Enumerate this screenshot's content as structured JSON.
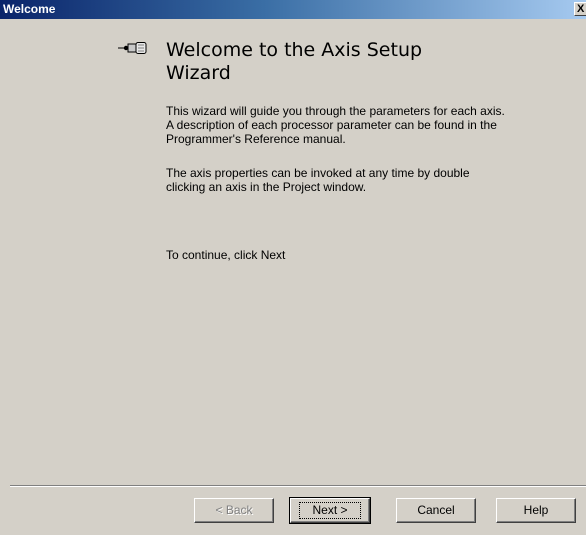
{
  "window": {
    "title": "Welcome",
    "close_label": "X"
  },
  "content": {
    "heading": "Welcome to the Axis Setup Wizard",
    "paragraph1": "This wizard will guide you through the parameters for each axis. A description of each processor parameter can be found in the Programmer's Reference manual.",
    "paragraph2": "The axis properties can be invoked at any time by double clicking an axis in the Project window.",
    "paragraph3": "To continue, click Next"
  },
  "buttons": {
    "back": "< Back",
    "next": "Next >",
    "cancel": "Cancel",
    "help": "Help"
  },
  "icons": {
    "wizard_icon": "plug-connector-icon"
  },
  "colors": {
    "title_bar_start": "#0a246a",
    "title_bar_end": "#a6caf0",
    "dialog_face": "#d4d0c8"
  }
}
